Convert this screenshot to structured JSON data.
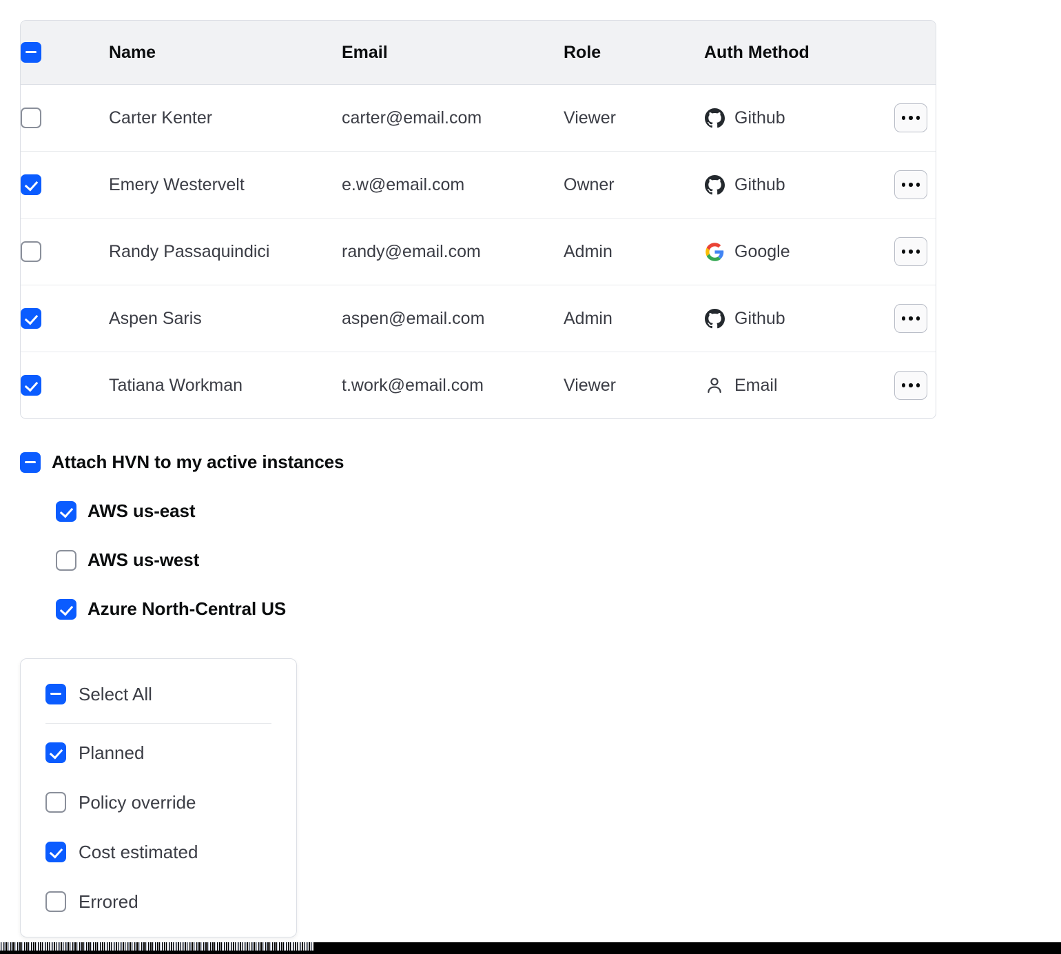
{
  "users_table": {
    "header": {
      "select_all_state": "indeterminate",
      "columns": [
        "Name",
        "Email",
        "Role",
        "Auth Method"
      ]
    },
    "rows": [
      {
        "selected": false,
        "name": "Carter Kenter",
        "email": "carter@email.com",
        "role": "Viewer",
        "auth_method": "Github",
        "auth_icon": "github-icon"
      },
      {
        "selected": true,
        "name": "Emery Westervelt",
        "email": "e.w@email.com",
        "role": "Owner",
        "auth_method": "Github",
        "auth_icon": "github-icon"
      },
      {
        "selected": false,
        "name": "Randy Passaquindici",
        "email": "randy@email.com",
        "role": "Admin",
        "auth_method": "Google",
        "auth_icon": "google-icon"
      },
      {
        "selected": true,
        "name": "Aspen Saris",
        "email": "aspen@email.com",
        "role": "Admin",
        "auth_method": "Github",
        "auth_icon": "github-icon"
      },
      {
        "selected": true,
        "name": "Tatiana Workman",
        "email": "t.work@email.com",
        "role": "Viewer",
        "auth_method": "Email",
        "auth_icon": "user-icon"
      }
    ],
    "row_action_icon": "more-horizontal-icon"
  },
  "hvn_group": {
    "parent": {
      "label": "Attach HVN to my active instances",
      "state": "indeterminate"
    },
    "children": [
      {
        "label": "AWS us-east",
        "checked": true
      },
      {
        "label": "AWS us-west",
        "checked": false
      },
      {
        "label": "Azure North-Central US",
        "checked": true
      }
    ]
  },
  "dropdown": {
    "select_all": {
      "label": "Select All",
      "state": "indeterminate"
    },
    "options": [
      {
        "label": "Planned",
        "checked": true
      },
      {
        "label": "Policy override",
        "checked": false
      },
      {
        "label": "Cost estimated",
        "checked": true
      },
      {
        "label": "Errored",
        "checked": false
      }
    ]
  },
  "colors": {
    "accent_blue": "#0B5CFF",
    "header_bg": "#F1F2F4",
    "border": "#DCDFE5",
    "row_divider": "#E8EAED",
    "text_primary": "#0B0D0E",
    "text_secondary": "#3B3D45",
    "checkbox_border": "#8A8F9A",
    "github_dark": "#24292E",
    "google_blue": "#4285F4",
    "google_red": "#EA4335",
    "google_yellow": "#FBBC05",
    "google_green": "#34A853"
  }
}
